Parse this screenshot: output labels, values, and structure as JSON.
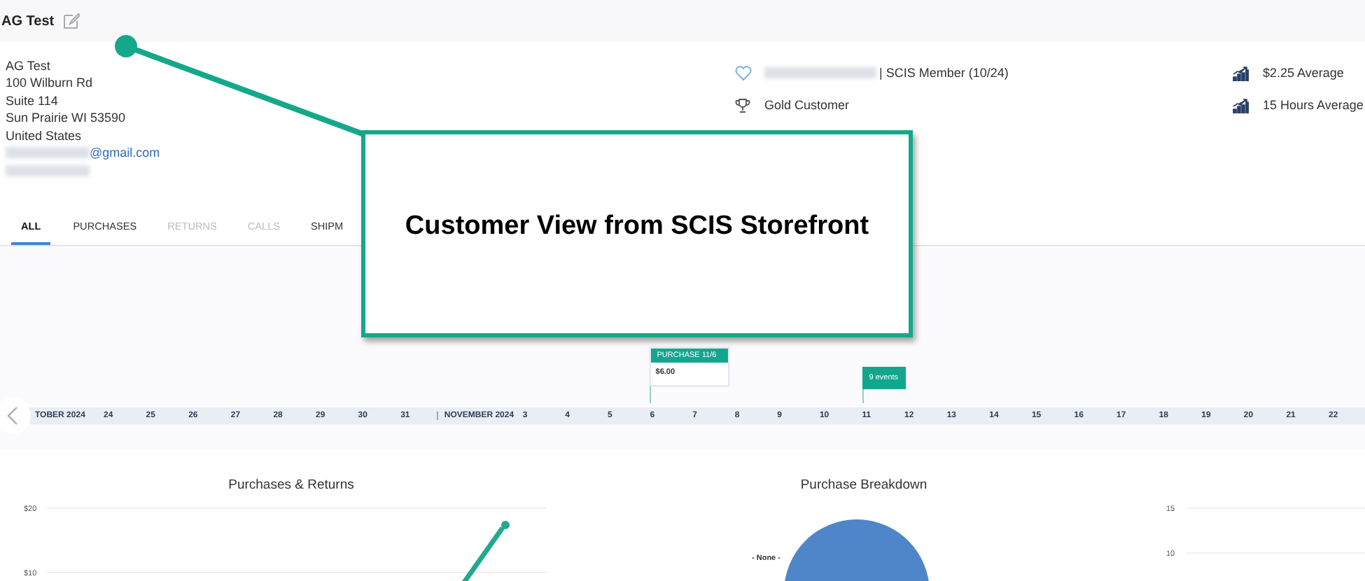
{
  "header": {
    "title": "AG Test"
  },
  "customer": {
    "address_lines": [
      "AG Test",
      "100 Wilburn Rd",
      "Suite 114",
      "Sun Prairie WI 53590",
      "United States"
    ],
    "email_domain": "@gmail.com"
  },
  "membership": {
    "text": "| SCIS Member (10/24)",
    "tier": "Gold Customer"
  },
  "stats": [
    "$2.25 Average",
    "15 Hours Average"
  ],
  "tabs": [
    {
      "label": "ALL",
      "selected": true,
      "disabled": false
    },
    {
      "label": "PURCHASES",
      "selected": false,
      "disabled": false
    },
    {
      "label": "RETURNS",
      "selected": false,
      "disabled": true
    },
    {
      "label": "CALLS",
      "selected": false,
      "disabled": true
    },
    {
      "label": "SHIPM",
      "selected": false,
      "disabled": false
    }
  ],
  "timeline": {
    "months": [
      {
        "label": "TOBER 2024",
        "days": [
          {
            "label": "24"
          },
          {
            "label": "25"
          },
          {
            "label": "26"
          },
          {
            "label": "27"
          },
          {
            "label": "28"
          },
          {
            "label": "29"
          },
          {
            "label": "30"
          },
          {
            "label": "31"
          }
        ]
      },
      {
        "label": "NOVEMBER 2024",
        "days": [
          {
            "label": "3"
          },
          {
            "label": "4"
          },
          {
            "label": "5"
          },
          {
            "label": "6",
            "event": {
              "kind": "card",
              "title": "PURCHASE 11/6",
              "amount": "$6.00"
            }
          },
          {
            "label": "7"
          },
          {
            "label": "8"
          },
          {
            "label": "9"
          },
          {
            "label": "10"
          },
          {
            "label": "11",
            "event": {
              "kind": "tag",
              "title": "9 events"
            }
          },
          {
            "label": "12"
          },
          {
            "label": "13"
          },
          {
            "label": "14"
          },
          {
            "label": "15"
          },
          {
            "label": "16"
          },
          {
            "label": "17"
          },
          {
            "label": "18"
          },
          {
            "label": "19"
          },
          {
            "label": "20"
          },
          {
            "label": "21"
          },
          {
            "label": "22"
          }
        ]
      }
    ]
  },
  "charts": [
    {
      "kind": "line",
      "title": "Purchases & Returns",
      "y_labels": [
        "$20",
        "$10"
      ]
    },
    {
      "kind": "pie",
      "title": "Purchase Breakdown",
      "slice_label": "- None -"
    },
    {
      "kind": "axis",
      "y_labels": [
        "15",
        "10"
      ]
    }
  ],
  "callout": {
    "text": "Customer View from SCIS Storefront"
  }
}
